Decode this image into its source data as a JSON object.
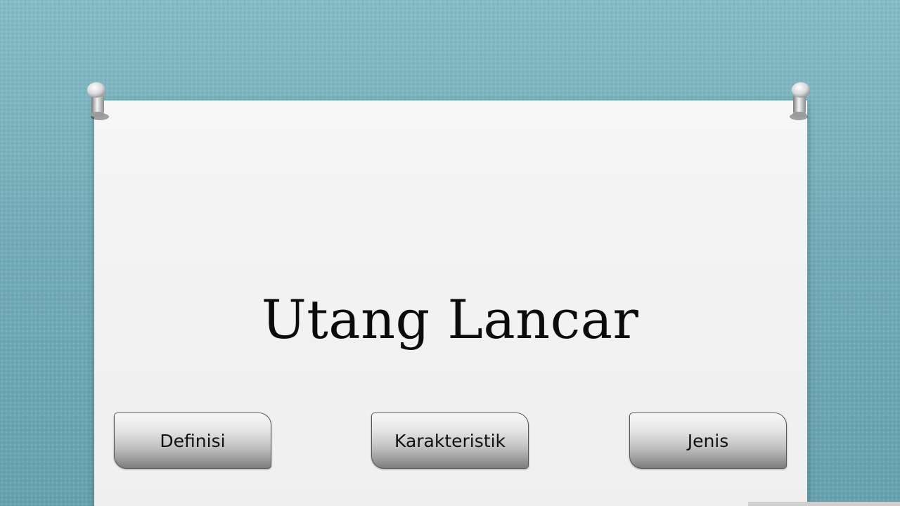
{
  "slide": {
    "title": "Utang Lancar",
    "buttons": [
      {
        "label": "Definisi"
      },
      {
        "label": "Karakteristik"
      },
      {
        "label": "Jenis"
      }
    ]
  },
  "colors": {
    "background": "#6fa7b3",
    "paper": "#f3f3f3",
    "title_text": "#0b0b0b",
    "button_text": "#111111"
  },
  "icons": {
    "pin_left": "push-pin-icon",
    "pin_right": "push-pin-icon"
  }
}
